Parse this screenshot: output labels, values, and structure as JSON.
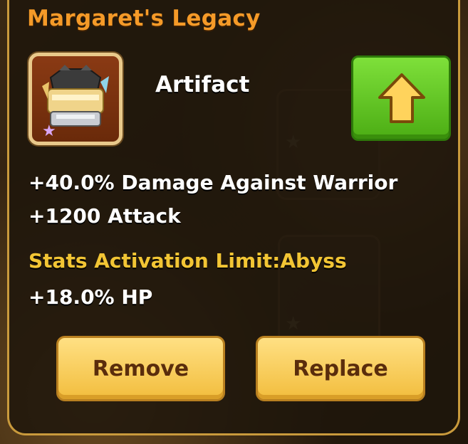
{
  "item": {
    "name": "Margaret's Legacy",
    "type": "Artifact",
    "stars": 1
  },
  "stats": {
    "line1": "+40.0% Damage Against Warrior",
    "line2": "+1200 Attack",
    "activation_limit": "Stats Activation Limit:Abyss",
    "line3": "+18.0% HP"
  },
  "buttons": {
    "upgrade_icon": "arrow-up-icon",
    "remove": "Remove",
    "replace": "Replace"
  },
  "colors": {
    "title": "#f59a28",
    "limit_text": "#f2c534",
    "upgrade_button": "#5cc41e",
    "action_button": "#f7cd5a"
  }
}
